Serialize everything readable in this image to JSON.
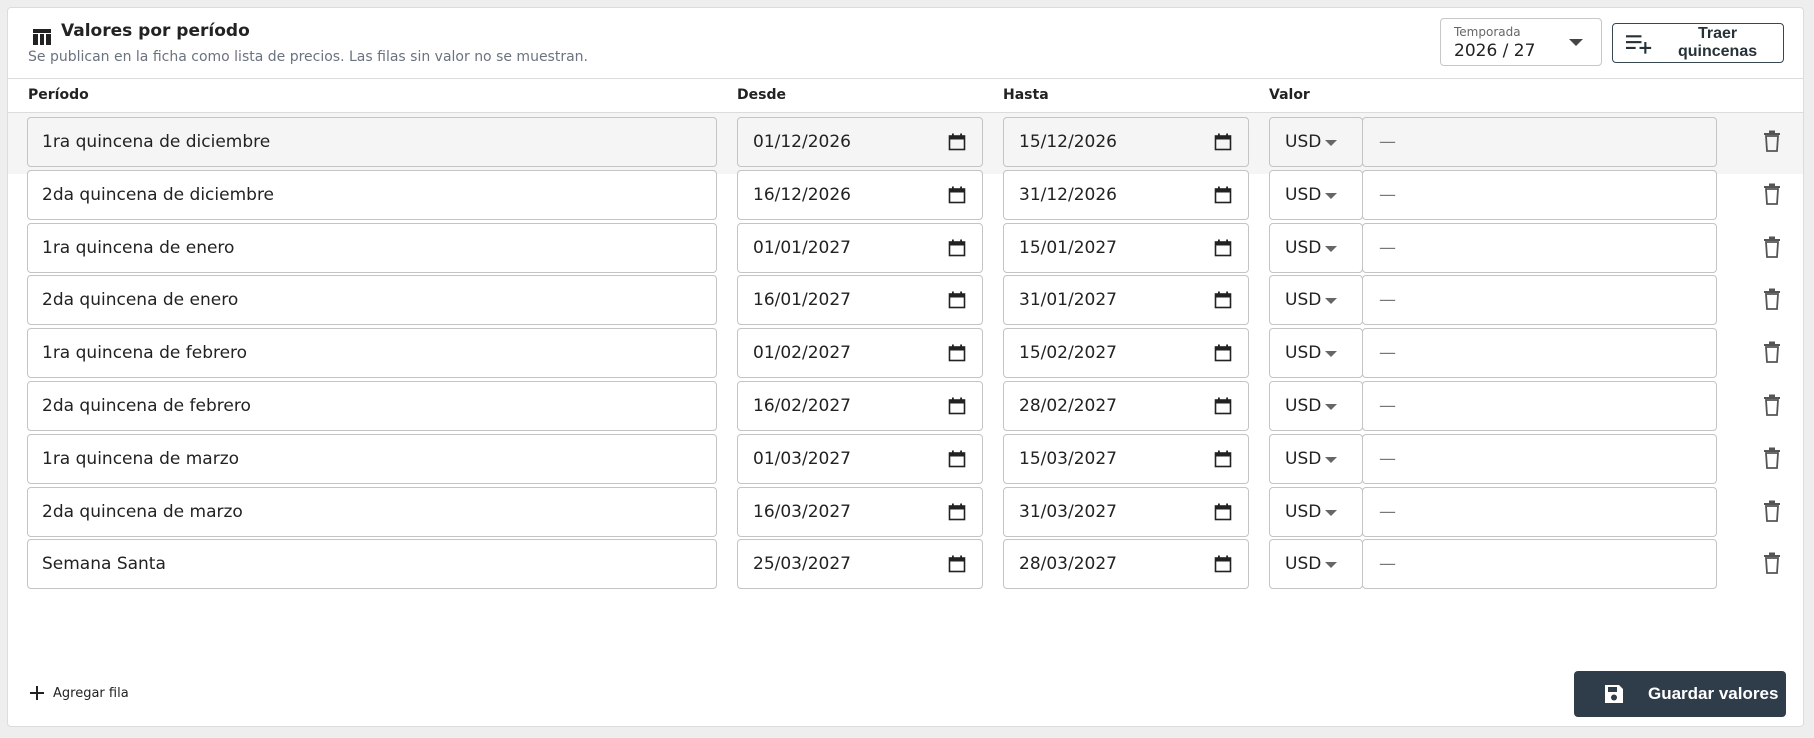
{
  "header": {
    "title": "Valores por período",
    "subtitle": "Se publican en la ficha como lista de precios. Las filas sin valor no se muestran.",
    "title_icon": "table-icon"
  },
  "season": {
    "label": "Temporada",
    "value": "2026 / 27"
  },
  "actions": {
    "fetch_label": "Traer quincenas",
    "fetch_icon": "playlist-add-icon",
    "add_row_label": "Agregar fila",
    "save_label": "Guardar valores",
    "save_icon": "save-icon"
  },
  "columns": {
    "period": "Período",
    "from": "Desde",
    "to": "Hasta",
    "value": "Valor"
  },
  "rows": [
    {
      "name": "1ra quincena de diciembre",
      "from": "01/12/2026",
      "to": "15/12/2026",
      "currency": "USD",
      "value": "—"
    },
    {
      "name": "2da quincena de diciembre",
      "from": "16/12/2026",
      "to": "31/12/2026",
      "currency": "USD",
      "value": "—"
    },
    {
      "name": "1ra quincena de enero",
      "from": "01/01/2027",
      "to": "15/01/2027",
      "currency": "USD",
      "value": "—"
    },
    {
      "name": "2da quincena de enero",
      "from": "16/01/2027",
      "to": "31/01/2027",
      "currency": "USD",
      "value": "—"
    },
    {
      "name": "1ra quincena de febrero",
      "from": "01/02/2027",
      "to": "15/02/2027",
      "currency": "USD",
      "value": "—"
    },
    {
      "name": "2da quincena de febrero",
      "from": "16/02/2027",
      "to": "28/02/2027",
      "currency": "USD",
      "value": "—"
    },
    {
      "name": "1ra quincena de marzo",
      "from": "01/03/2027",
      "to": "15/03/2027",
      "currency": "USD",
      "value": "—"
    },
    {
      "name": "2da quincena de marzo",
      "from": "16/03/2027",
      "to": "31/03/2027",
      "currency": "USD",
      "value": "—"
    },
    {
      "name": "Semana Santa",
      "from": "25/03/2027",
      "to": "28/03/2027",
      "currency": "USD",
      "value": "—"
    }
  ],
  "colors": {
    "primary_dark": "#2f3c4a",
    "border": "#c4c4c4",
    "muted_text": "#6b7280"
  }
}
